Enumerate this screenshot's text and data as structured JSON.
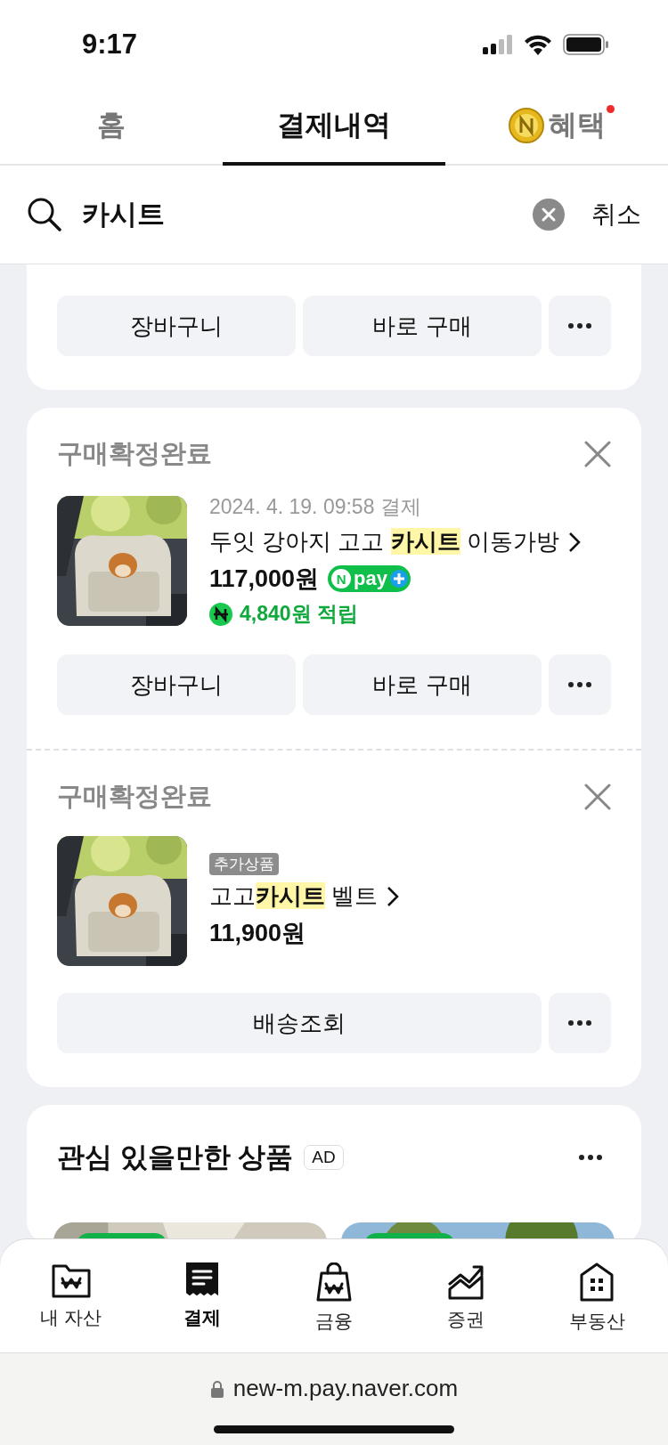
{
  "status_bar": {
    "time": "9:17"
  },
  "tabs": [
    {
      "label": "홈",
      "selected": false,
      "coin": false,
      "new_dot": false
    },
    {
      "label": "결제내역",
      "selected": true,
      "coin": false,
      "new_dot": false
    },
    {
      "label": "혜택",
      "selected": false,
      "coin": true,
      "new_dot": true
    }
  ],
  "search": {
    "value": "카시트",
    "cancel": "취소"
  },
  "partial_card": {
    "buttons": [
      {
        "kind": "text",
        "label": "장바구니"
      },
      {
        "kind": "text",
        "label": "바로 구매"
      },
      {
        "kind": "more"
      }
    ]
  },
  "order_card": {
    "items": [
      {
        "status": "구매확정완료",
        "date": "2024. 4. 19. 09:58 결제",
        "title": [
          {
            "text": "두잇 강아지 고고 ",
            "highlight": false
          },
          {
            "text": "카시트",
            "highlight": true
          },
          {
            "text": " 이동가방",
            "highlight": false
          }
        ],
        "price": "117,000원",
        "pay_badge": {
          "logo": "N",
          "label": "pay"
        },
        "points": "4,840원 적립",
        "buttons": [
          {
            "kind": "text",
            "label": "장바구니"
          },
          {
            "kind": "text",
            "label": "바로 구매"
          },
          {
            "kind": "more"
          }
        ]
      },
      {
        "status": "구매확정완료",
        "tag": "추가상품",
        "title": [
          {
            "text": "고고",
            "highlight": false
          },
          {
            "text": "카시트",
            "highlight": true
          },
          {
            "text": " 벨트",
            "highlight": false
          }
        ],
        "price": "11,900원",
        "buttons": [
          {
            "kind": "text",
            "label": "배송조회"
          },
          {
            "kind": "more"
          }
        ]
      }
    ]
  },
  "ad_section": {
    "title": "관심 있을만한 상품",
    "badge": "AD"
  },
  "bottom_nav": [
    {
      "label": "내 자산",
      "selected": false
    },
    {
      "label": "결제",
      "selected": true
    },
    {
      "label": "금융",
      "selected": false
    },
    {
      "label": "증권",
      "selected": false
    },
    {
      "label": "부동산",
      "selected": false
    }
  ],
  "browser": {
    "url": "new-m.pay.naver.com"
  }
}
